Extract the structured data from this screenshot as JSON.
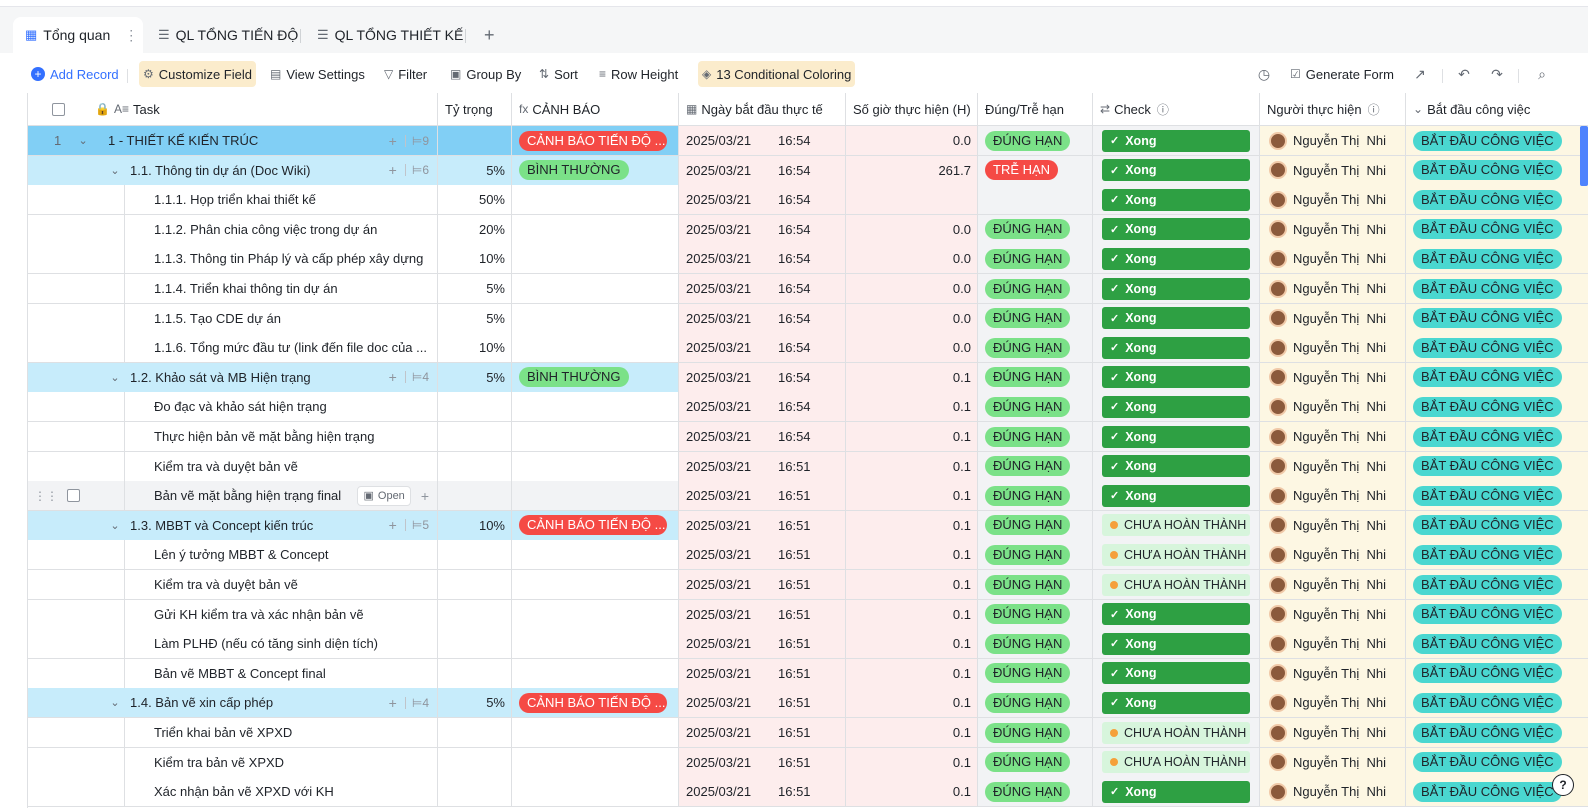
{
  "tabs": [
    {
      "label": "Tổng quan",
      "icon": "table-icon",
      "active": true
    },
    {
      "label": "QL TỔNG TIẾN ĐỘ",
      "icon": "gantt-icon"
    },
    {
      "label": "QL TỔNG THIẾT KẾ",
      "icon": "gantt-icon"
    }
  ],
  "toolbar": {
    "add_record": "Add Record",
    "customize_field": "Customize Field",
    "view_settings": "View Settings",
    "filter": "Filter",
    "group_by": "Group By",
    "sort": "Sort",
    "row_height": "Row Height",
    "conditional_coloring": "13 Conditional Coloring",
    "generate_form": "Generate Form"
  },
  "columns": {
    "task": "Task",
    "ty_trong": "Tỷ trọng",
    "canh_bao": "CẢNH BÁO",
    "ngay_bat_dau": "Ngày bắt đầu thực tế",
    "so_gio": "Số giờ thực hiện (H)",
    "dung_tre_han": "Đúng/Trễ hạn",
    "check": "Check",
    "nguoi_thuc_hien": "Người thực hiện",
    "bat_dau_cong_viec": "Bắt đầu công việc"
  },
  "colors": {
    "group1_bg": "#81cff5",
    "group2_bg": "#c7ecfb",
    "date_bg": "#fdeded",
    "hours_bg": "#fdeded",
    "status_bg": "#f2f3f5",
    "person_bg": "#fdf7e3",
    "start_bg": "#fdf7e3",
    "red_pill": "#f54a45",
    "green_pill": "#7be188",
    "teal_pill": "#4ad7d0",
    "check_done": "#2ea043"
  },
  "hover_open_label": "Open",
  "rows": [
    {
      "level": 1,
      "rownum": "1",
      "task": "1 - THIẾT KẾ KIẾN TRÚC",
      "count": "9",
      "weight": "",
      "alert": "CẢNH BÁO TIẾN ĐỘ ...",
      "alert_color": "red",
      "date": "2025/03/21",
      "time": "16:54",
      "hours": "0.0",
      "due": "ĐÚNG HẠN",
      "due_color": "green",
      "check": "Xong",
      "person": "Nguyễn Thị  Nhi",
      "start": "BẮT ĐẦU CÔNG VIỆC"
    },
    {
      "level": 2,
      "task": "1.1. Thông tin dự án (Doc Wiki)",
      "count": "6",
      "weight": "5%",
      "alert": "BÌNH THƯỜNG",
      "alert_color": "green",
      "date": "2025/03/21",
      "time": "16:54",
      "hours": "261.7",
      "due": "TRỄ HẠN",
      "due_color": "red",
      "check": "Xong",
      "person": "Nguyễn Thị  Nhi",
      "start": "BẮT ĐẦU CÔNG VIỆC"
    },
    {
      "level": 3,
      "task": "1.1.1. Họp triển khai thiết kế",
      "weight": "50%",
      "alert": "",
      "date": "2025/03/21",
      "time": "16:54",
      "hours": "",
      "due": "",
      "check": "Xong",
      "person": "Nguyễn Thị  Nhi",
      "start": "BẮT ĐẦU CÔNG VIỆC"
    },
    {
      "level": 3,
      "task": "1.1.2. Phân chia công việc trong dự án",
      "weight": "20%",
      "alert": "",
      "date": "2025/03/21",
      "time": "16:54",
      "hours": "0.0",
      "due": "ĐÚNG HẠN",
      "due_color": "green",
      "check": "Xong",
      "person": "Nguyễn Thị  Nhi",
      "start": "BẮT ĐẦU CÔNG VIỆC"
    },
    {
      "level": 3,
      "task": "1.1.3. Thông tin Pháp lý và cấp phép xây dựng",
      "weight": "10%",
      "alert": "",
      "date": "2025/03/21",
      "time": "16:54",
      "hours": "0.0",
      "due": "ĐÚNG HẠN",
      "due_color": "green",
      "check": "Xong",
      "person": "Nguyễn Thị  Nhi",
      "start": "BẮT ĐẦU CÔNG VIỆC"
    },
    {
      "level": 3,
      "task": "1.1.4. Triển khai thông tin dự án",
      "weight": "5%",
      "alert": "",
      "date": "2025/03/21",
      "time": "16:54",
      "hours": "0.0",
      "due": "ĐÚNG HẠN",
      "due_color": "green",
      "check": "Xong",
      "person": "Nguyễn Thị  Nhi",
      "start": "BẮT ĐẦU CÔNG VIỆC"
    },
    {
      "level": 3,
      "task": "1.1.5. Tạo CDE dự án",
      "weight": "5%",
      "alert": "",
      "date": "2025/03/21",
      "time": "16:54",
      "hours": "0.0",
      "due": "ĐÚNG HẠN",
      "due_color": "green",
      "check": "Xong",
      "person": "Nguyễn Thị  Nhi",
      "start": "BẮT ĐẦU CÔNG VIỆC"
    },
    {
      "level": 3,
      "task": "1.1.6. Tổng mức đầu tư (link đến file doc của ...",
      "weight": "10%",
      "alert": "",
      "date": "2025/03/21",
      "time": "16:54",
      "hours": "0.0",
      "due": "ĐÚNG HẠN",
      "due_color": "green",
      "check": "Xong",
      "person": "Nguyễn Thị  Nhi",
      "start": "BẮT ĐẦU CÔNG VIỆC"
    },
    {
      "level": 2,
      "task": "1.2. Khảo sát và MB Hiện trạng",
      "count": "4",
      "weight": "5%",
      "alert": "BÌNH THƯỜNG",
      "alert_color": "green",
      "date": "2025/03/21",
      "time": "16:54",
      "hours": "0.1",
      "due": "ĐÚNG HẠN",
      "due_color": "green",
      "check": "Xong",
      "person": "Nguyễn Thị  Nhi",
      "start": "BẮT ĐẦU CÔNG VIỆC"
    },
    {
      "level": 3,
      "task": "Đo đạc và khảo sát hiện trạng",
      "weight": "",
      "alert": "",
      "date": "2025/03/21",
      "time": "16:54",
      "hours": "0.1",
      "due": "ĐÚNG HẠN",
      "due_color": "green",
      "check": "Xong",
      "person": "Nguyễn Thị  Nhi",
      "start": "BẮT ĐẦU CÔNG VIỆC"
    },
    {
      "level": 3,
      "task": "Thực hiện bản vẽ mặt bằng hiện trạng",
      "weight": "",
      "alert": "",
      "date": "2025/03/21",
      "time": "16:54",
      "hours": "0.1",
      "due": "ĐÚNG HẠN",
      "due_color": "green",
      "check": "Xong",
      "person": "Nguyễn Thị  Nhi",
      "start": "BẮT ĐẦU CÔNG VIỆC"
    },
    {
      "level": 3,
      "task": "Kiểm tra và duyệt bản vẽ",
      "weight": "",
      "alert": "",
      "date": "2025/03/21",
      "time": "16:51",
      "hours": "0.1",
      "due": "ĐÚNG HẠN",
      "due_color": "green",
      "check": "Xong",
      "person": "Nguyễn Thị  Nhi",
      "start": "BẮT ĐẦU CÔNG VIỆC"
    },
    {
      "level": 3,
      "hover": true,
      "task": "Bản vẽ mặt bằng hiện trạng final",
      "weight": "",
      "alert": "",
      "date": "2025/03/21",
      "time": "16:51",
      "hours": "0.1",
      "due": "ĐÚNG HẠN",
      "due_color": "green",
      "check": "Xong",
      "person": "Nguyễn Thị  Nhi",
      "start": "BẮT ĐẦU CÔNG VIỆC"
    },
    {
      "level": 2,
      "task": "1.3. MBBT và Concept kiến trúc",
      "count": "5",
      "weight": "10%",
      "alert": "CẢNH BÁO TIẾN ĐỘ ...",
      "alert_color": "red",
      "date": "2025/03/21",
      "time": "16:51",
      "hours": "0.1",
      "due": "ĐÚNG HẠN",
      "due_color": "green",
      "check": "CHƯA HOÀN THÀNH",
      "check_pending": true,
      "person": "Nguyễn Thị  Nhi",
      "start": "BẮT ĐẦU CÔNG VIỆC"
    },
    {
      "level": 3,
      "task": "Lên ý tưởng MBBT & Concept",
      "weight": "",
      "alert": "",
      "date": "2025/03/21",
      "time": "16:51",
      "hours": "0.1",
      "due": "ĐÚNG HẠN",
      "due_color": "green",
      "check": "CHƯA HOÀN THÀNH",
      "check_pending": true,
      "person": "Nguyễn Thị  Nhi",
      "start": "BẮT ĐẦU CÔNG VIỆC"
    },
    {
      "level": 3,
      "task": "Kiểm tra và duyệt bản vẽ",
      "weight": "",
      "alert": "",
      "date": "2025/03/21",
      "time": "16:51",
      "hours": "0.1",
      "due": "ĐÚNG HẠN",
      "due_color": "green",
      "check": "CHƯA HOÀN THÀNH",
      "check_pending": true,
      "person": "Nguyễn Thị  Nhi",
      "start": "BẮT ĐẦU CÔNG VIỆC"
    },
    {
      "level": 3,
      "task": "Gửi KH kiểm tra và xác nhận bản vẽ",
      "weight": "",
      "alert": "",
      "date": "2025/03/21",
      "time": "16:51",
      "hours": "0.1",
      "due": "ĐÚNG HẠN",
      "due_color": "green",
      "check": "Xong",
      "person": "Nguyễn Thị  Nhi",
      "start": "BẮT ĐẦU CÔNG VIỆC"
    },
    {
      "level": 3,
      "task": "Làm PLHĐ (nếu có tăng sinh diện tích)",
      "weight": "",
      "alert": "",
      "date": "2025/03/21",
      "time": "16:51",
      "hours": "0.1",
      "due": "ĐÚNG HẠN",
      "due_color": "green",
      "check": "Xong",
      "person": "Nguyễn Thị  Nhi",
      "start": "BẮT ĐẦU CÔNG VIỆC"
    },
    {
      "level": 3,
      "task": "Bản vẽ MBBT & Concept final",
      "weight": "",
      "alert": "",
      "date": "2025/03/21",
      "time": "16:51",
      "hours": "0.1",
      "due": "ĐÚNG HẠN",
      "due_color": "green",
      "check": "Xong",
      "person": "Nguyễn Thị  Nhi",
      "start": "BẮT ĐẦU CÔNG VIỆC"
    },
    {
      "level": 2,
      "task": "1.4. Bản vẽ xin cấp phép",
      "count": "4",
      "weight": "5%",
      "alert": "CẢNH BÁO TIẾN ĐỘ ...",
      "alert_color": "red",
      "date": "2025/03/21",
      "time": "16:51",
      "hours": "0.1",
      "due": "ĐÚNG HẠN",
      "due_color": "green",
      "check": "Xong",
      "person": "Nguyễn Thị  Nhi",
      "start": "BẮT ĐẦU CÔNG VIỆC"
    },
    {
      "level": 3,
      "task": "Triển khai bản vẽ XPXD",
      "weight": "",
      "alert": "",
      "date": "2025/03/21",
      "time": "16:51",
      "hours": "0.1",
      "due": "ĐÚNG HẠN",
      "due_color": "green",
      "check": "CHƯA HOÀN THÀNH",
      "check_pending": true,
      "person": "Nguyễn Thị  Nhi",
      "start": "BẮT ĐẦU CÔNG VIỆC"
    },
    {
      "level": 3,
      "task": "Kiểm tra bản vẽ XPXD",
      "weight": "",
      "alert": "",
      "date": "2025/03/21",
      "time": "16:51",
      "hours": "0.1",
      "due": "ĐÚNG HẠN",
      "due_color": "green",
      "check": "CHƯA HOÀN THÀNH",
      "check_pending": true,
      "person": "Nguyễn Thị  Nhi",
      "start": "BẮT ĐẦU CÔNG VIỆC"
    },
    {
      "level": 3,
      "task": "Xác nhận bản vẽ XPXD với KH",
      "weight": "",
      "alert": "",
      "date": "2025/03/21",
      "time": "16:51",
      "hours": "0.1",
      "due": "ĐÚNG HẠN",
      "due_color": "green",
      "check": "Xong",
      "person": "Nguyễn Thị  Nhi",
      "start": "BẮT ĐẦU CÔNG VIỆC"
    }
  ]
}
